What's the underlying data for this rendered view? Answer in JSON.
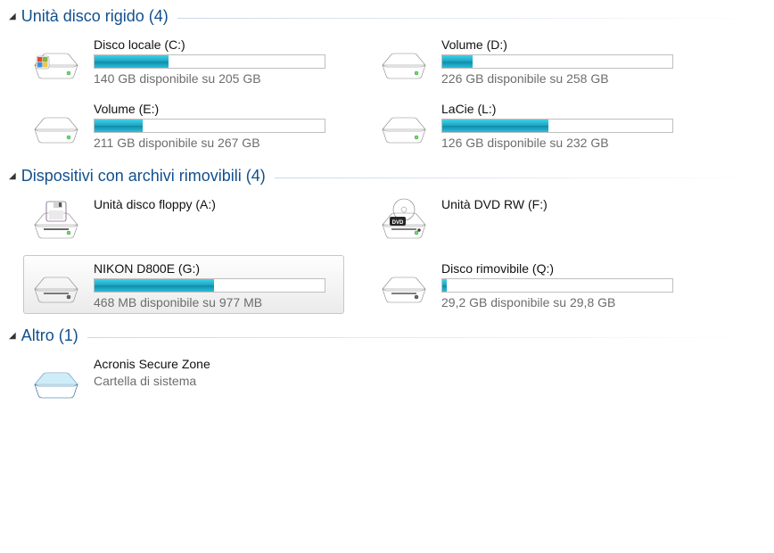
{
  "groups": [
    {
      "title": "Unità disco rigido (4)",
      "items": [
        {
          "name": "Disco locale (C:)",
          "sub": "140 GB disponibile su 205 GB",
          "fill": 32,
          "icon": "hdd-windows",
          "showBar": true
        },
        {
          "name": "Volume (D:)",
          "sub": "226 GB disponibile su 258 GB",
          "fill": 13,
          "icon": "hdd",
          "showBar": true
        },
        {
          "name": "Volume (E:)",
          "sub": "211 GB disponibile su 267 GB",
          "fill": 21,
          "icon": "hdd",
          "showBar": true
        },
        {
          "name": "LaCie (L:)",
          "sub": "126 GB disponibile su 232 GB",
          "fill": 46,
          "icon": "hdd",
          "showBar": true
        }
      ]
    },
    {
      "title": "Dispositivi con archivi rimovibili (4)",
      "items": [
        {
          "name": "Unità disco floppy (A:)",
          "sub": "",
          "icon": "floppy",
          "showBar": false
        },
        {
          "name": "Unità DVD RW (F:)",
          "sub": "",
          "icon": "dvd",
          "showBar": false
        },
        {
          "name": "NIKON D800E (G:)",
          "sub": "468 MB disponibile su 977 MB",
          "fill": 52,
          "icon": "removable",
          "showBar": true,
          "selected": true
        },
        {
          "name": "Disco rimovibile (Q:)",
          "sub": "29,2 GB disponibile su 29,8 GB",
          "fill": 2,
          "icon": "removable",
          "showBar": true
        }
      ]
    },
    {
      "title": "Altro (1)",
      "items": [
        {
          "name": "Acronis Secure Zone",
          "sub": "Cartella di sistema",
          "icon": "secure",
          "showBar": false
        }
      ]
    }
  ]
}
